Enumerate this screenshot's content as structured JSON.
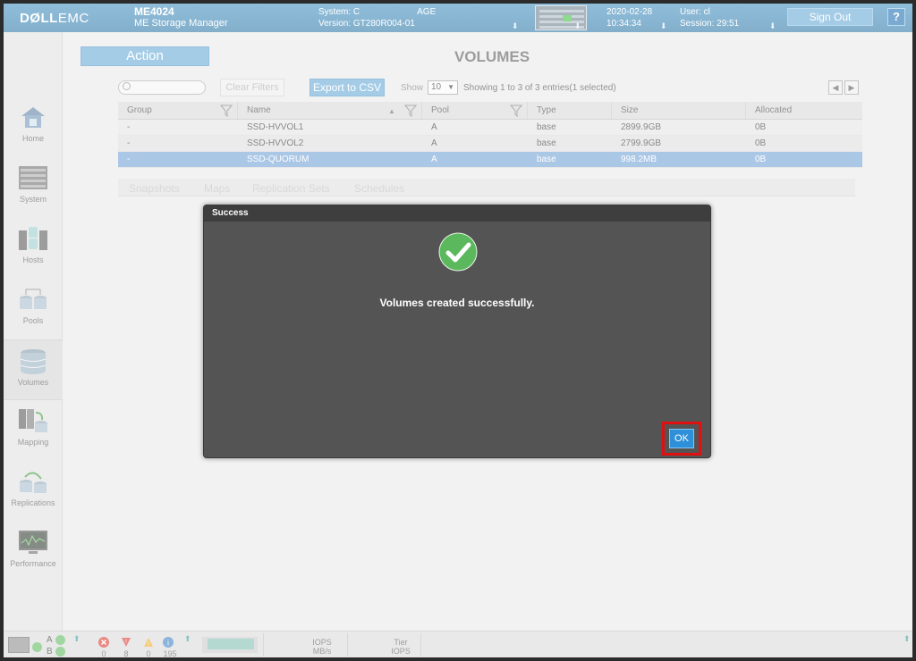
{
  "header": {
    "logo_bold": "DØLL",
    "logo_rest": "EMC",
    "product_title": "ME4024",
    "product_subtitle": "ME Storage Manager",
    "system_label": "System: C",
    "system_suffix": "AGE",
    "version_label": "Version: GT280R004-01",
    "date": "2020-02-28",
    "time": "10:34:34",
    "user_label": "User: cl",
    "session_label": "Session: 29:51",
    "signout_label": "Sign Out",
    "help_label": "?"
  },
  "sidebar": {
    "items": [
      {
        "label": "Home"
      },
      {
        "label": "System"
      },
      {
        "label": "Hosts"
      },
      {
        "label": "Pools"
      },
      {
        "label": "Volumes"
      },
      {
        "label": "Mapping"
      },
      {
        "label": "Replications"
      },
      {
        "label": "Performance"
      }
    ],
    "active": "Volumes"
  },
  "main": {
    "action_label": "Action",
    "page_title": "VOLUMES",
    "search_placeholder": "",
    "clear_filters_label": "Clear Filters",
    "export_label": "Export to CSV",
    "show_label": "Show",
    "show_value": "10",
    "entries_text": "Showing 1 to 3 of 3 entries(1 selected)",
    "table": {
      "columns": [
        "Group",
        "Name",
        "Pool",
        "Type",
        "Size",
        "Allocated"
      ],
      "rows": [
        {
          "group": "-",
          "name": "SSD-HVVOL1",
          "pool": "A",
          "type": "base",
          "size": "2899.9GB",
          "allocated": "0B",
          "selected": false
        },
        {
          "group": "-",
          "name": "SSD-HVVOL2",
          "pool": "A",
          "type": "base",
          "size": "2799.9GB",
          "allocated": "0B",
          "selected": false
        },
        {
          "group": "-",
          "name": "SSD-QUORUM",
          "pool": "A",
          "type": "base",
          "size": "998.2MB",
          "allocated": "0B",
          "selected": true
        }
      ]
    },
    "subtabs": [
      "Snapshots",
      "Maps",
      "Replication Sets",
      "Schedules"
    ]
  },
  "dialog": {
    "title": "Success",
    "message": "Volumes created successfully.",
    "ok_label": "OK",
    "icon": "check-circle-icon"
  },
  "statusbar": {
    "controller_a": "A",
    "controller_b": "B",
    "error_count": "0",
    "critical_count": "8",
    "warning_count": "0",
    "info_count": "195",
    "iops_label": "IOPS",
    "mbs_label": "MB/s",
    "tier_label": "Tier",
    "tier_iops_label": "IOPS"
  },
  "colors": {
    "header_blue": "#2a75a6",
    "accent_blue": "#63a8d6",
    "selected_row": "#6f9fd4",
    "dialog_bg": "#545454",
    "success_green": "#5cb85c",
    "highlight_red": "#e01010"
  }
}
